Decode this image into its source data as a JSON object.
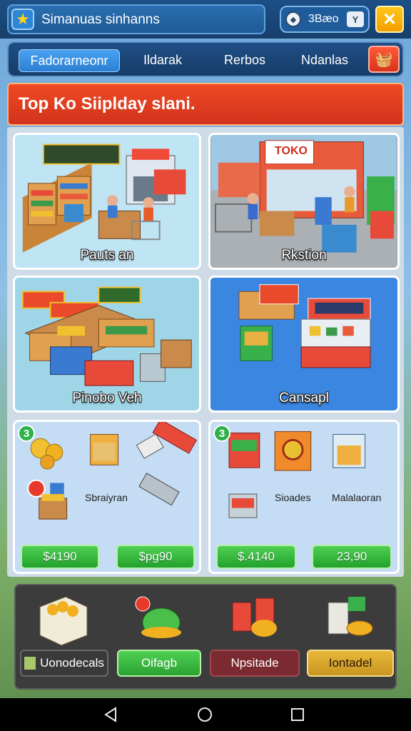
{
  "app": {
    "title": "Simanuas sinhanns"
  },
  "currency": {
    "value": "3Bæo"
  },
  "tabs": [
    {
      "label": "Fadorarneonr",
      "active": true
    },
    {
      "label": "Ildarak",
      "active": false
    },
    {
      "label": "Rerbos",
      "active": false
    },
    {
      "label": "Ndanlas",
      "active": false
    }
  ],
  "banner": {
    "title": "Top Ko Siiplday slani."
  },
  "scene_cards": [
    {
      "label": "Pauts an",
      "sign": ""
    },
    {
      "label": "Rkstion",
      "sign": "TOKO"
    },
    {
      "label": "Pinobo Veh",
      "sign": ""
    },
    {
      "label": "Cansapl",
      "sign": ""
    }
  ],
  "shop_cards": [
    {
      "badge": "3",
      "caption": "Sbraiyran",
      "prices": [
        "$4190",
        "$pg90"
      ]
    },
    {
      "badge": "3",
      "captions": [
        "Sioades",
        "Malalaoran"
      ],
      "prices": [
        "$.4140",
        "23,90"
      ]
    }
  ],
  "bottom_buttons": [
    {
      "label": "Uonodecals",
      "color": "#3a3a3a"
    },
    {
      "label": "Oifagb",
      "color": "#3fb34a"
    },
    {
      "label": "Npsitade",
      "color": "#7a2a30"
    },
    {
      "label": "Iontadel",
      "color": "#d4a22a"
    }
  ],
  "icons": [
    "star-icon",
    "coin-icon",
    "filter-icon",
    "close-icon",
    "basket-icon",
    "back-icon",
    "home-icon",
    "recents-icon"
  ]
}
